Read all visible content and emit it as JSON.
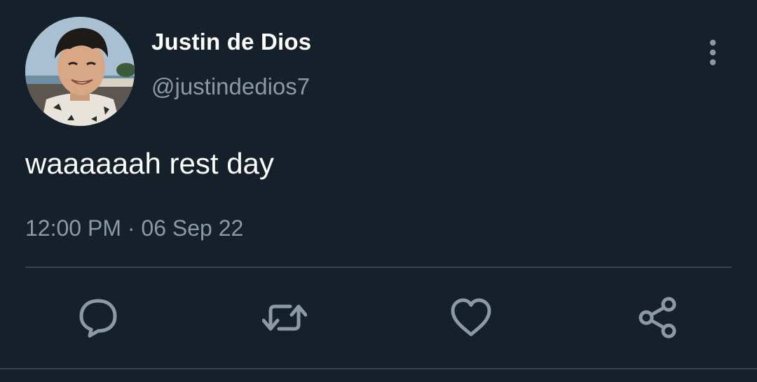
{
  "tweet": {
    "author": {
      "display_name": "Justin de Dios",
      "handle": "@justindedios7",
      "avatar": "profile-photo"
    },
    "text": "waaaaaah rest day",
    "timestamp": "12:00 PM · 06 Sep 22"
  },
  "actions": [
    {
      "icon": "reply-icon"
    },
    {
      "icon": "retweet-icon"
    },
    {
      "icon": "like-icon"
    },
    {
      "icon": "share-icon"
    }
  ],
  "colors": {
    "background": "#15202b",
    "primary_text": "#ffffff",
    "secondary_text": "#8b98a5",
    "divider": "#38444d"
  }
}
